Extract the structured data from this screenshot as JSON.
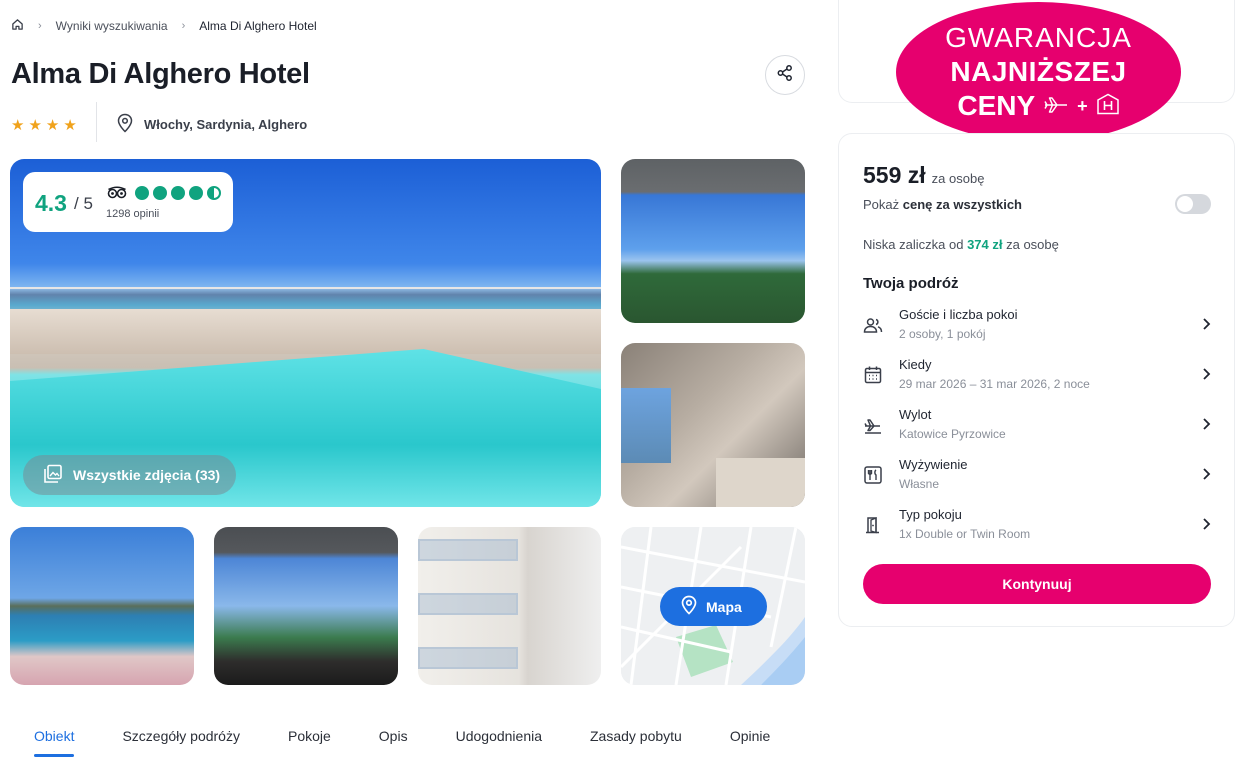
{
  "breadcrumb": {
    "items": [
      "Wyniki wyszukiwania",
      "Alma Di Alghero Hotel"
    ]
  },
  "hotel": {
    "name": "Alma Di Alghero Hotel",
    "stars": 4,
    "location": "Włochy, Sardynia, Alghero"
  },
  "rating": {
    "score": "4.3",
    "out_of": "/ 5",
    "reviews": "1298 opinii",
    "bubbles": 4.5
  },
  "gallery": {
    "all_photos_label": "Wszystkie zdjęcia (33)",
    "map_label": "Mapa"
  },
  "tabs": [
    "Obiekt",
    "Szczegóły podróży",
    "Pokoje",
    "Opis",
    "Udogodnienia",
    "Zasady pobytu",
    "Opinie"
  ],
  "promo": {
    "line1": "GWARANCJA",
    "line2": "NAJNIŻSZEJ",
    "line3": "CENY",
    "plus": "+",
    "badge_color": "#e6006e"
  },
  "booking": {
    "price": "559 zł",
    "price_unit": "za osobę",
    "show_total_prefix": "Pokaż",
    "show_total_bold": "cenę za wszystkich",
    "deposit_prefix": "Niska zaliczka od",
    "deposit_amount": "374 zł",
    "deposit_suffix": "za osobę",
    "trip_title": "Twoja podróż",
    "rows": [
      {
        "icon": "guests-icon",
        "label": "Goście i liczba pokoi",
        "value": "2 osoby, 1 pokój"
      },
      {
        "icon": "calendar-icon",
        "label": "Kiedy",
        "value": "29 mar 2026 – 31 mar 2026, 2 noce"
      },
      {
        "icon": "plane-departure-icon",
        "label": "Wylot",
        "value": "Katowice Pyrzowice"
      },
      {
        "icon": "cutlery-icon",
        "label": "Wyżywienie",
        "value": "Własne"
      },
      {
        "icon": "door-icon",
        "label": "Typ pokoju",
        "value": "1x Double or Twin Room"
      }
    ],
    "continue_label": "Kontynuuj"
  },
  "colors": {
    "accent_pink": "#e6006e",
    "accent_blue": "#1d6fe0",
    "rating_green": "#10a37f",
    "star": "#f0a21b"
  }
}
